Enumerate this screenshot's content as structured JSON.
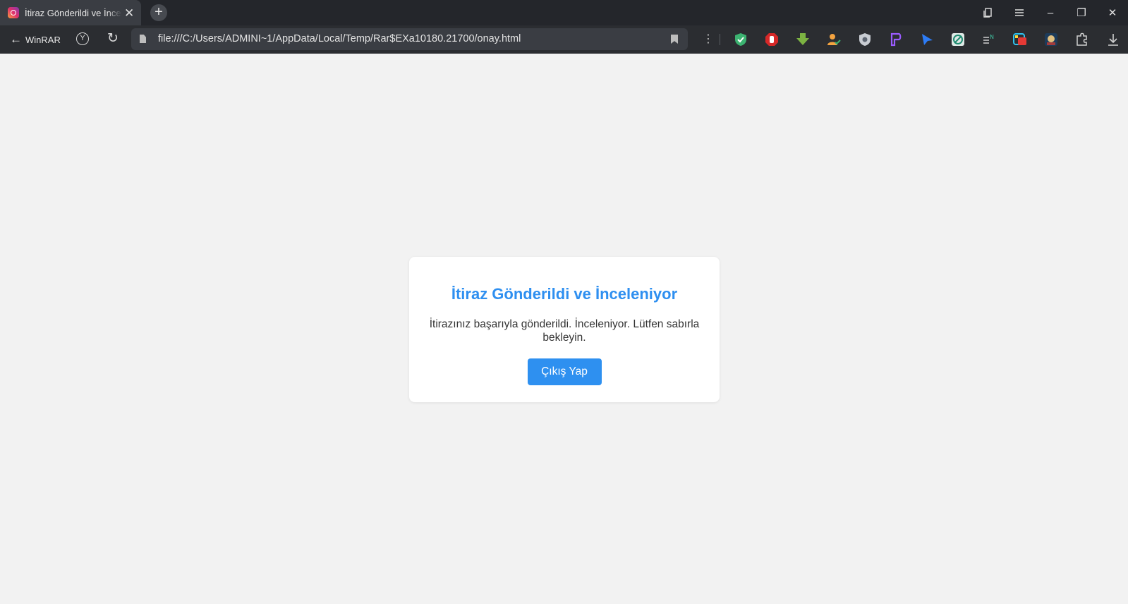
{
  "tab": {
    "title": "İtiraz Gönderildi ve İnceleniyor",
    "close_glyph": "✕",
    "favicon": "instagram-icon"
  },
  "new_tab_glyph": "+",
  "window_controls": {
    "minimize": "–",
    "restore": "❐",
    "close": "✕"
  },
  "toolbar": {
    "back_label": "WinRAR",
    "url": "file:///C:/Users/ADMINI~1/AppData/Local/Temp/Rar$EXa10180.21700/onay.html",
    "extensions": [
      "shield-check-icon",
      "stop-hand-icon",
      "download-arrow-icon",
      "person-check-icon",
      "privacy-badge-icon",
      "purple-p-icon",
      "blue-cursor-icon",
      "green-circle-icon",
      "en-reader-icon",
      "color-box-icon",
      "mascot-icon",
      "extensions-puzzle-icon",
      "downloads-icon"
    ]
  },
  "card": {
    "title": "İtiraz Gönderildi ve İnceleniyor",
    "message": "İtirazınız başarıyla gönderildi. İnceleniyor. Lütfen sabırla bekleyin.",
    "button_label": "Çıkış Yap"
  },
  "colors": {
    "accent": "#2e8ff0",
    "page_bg": "#f2f2f2",
    "titlebar_bg": "#24262b"
  }
}
